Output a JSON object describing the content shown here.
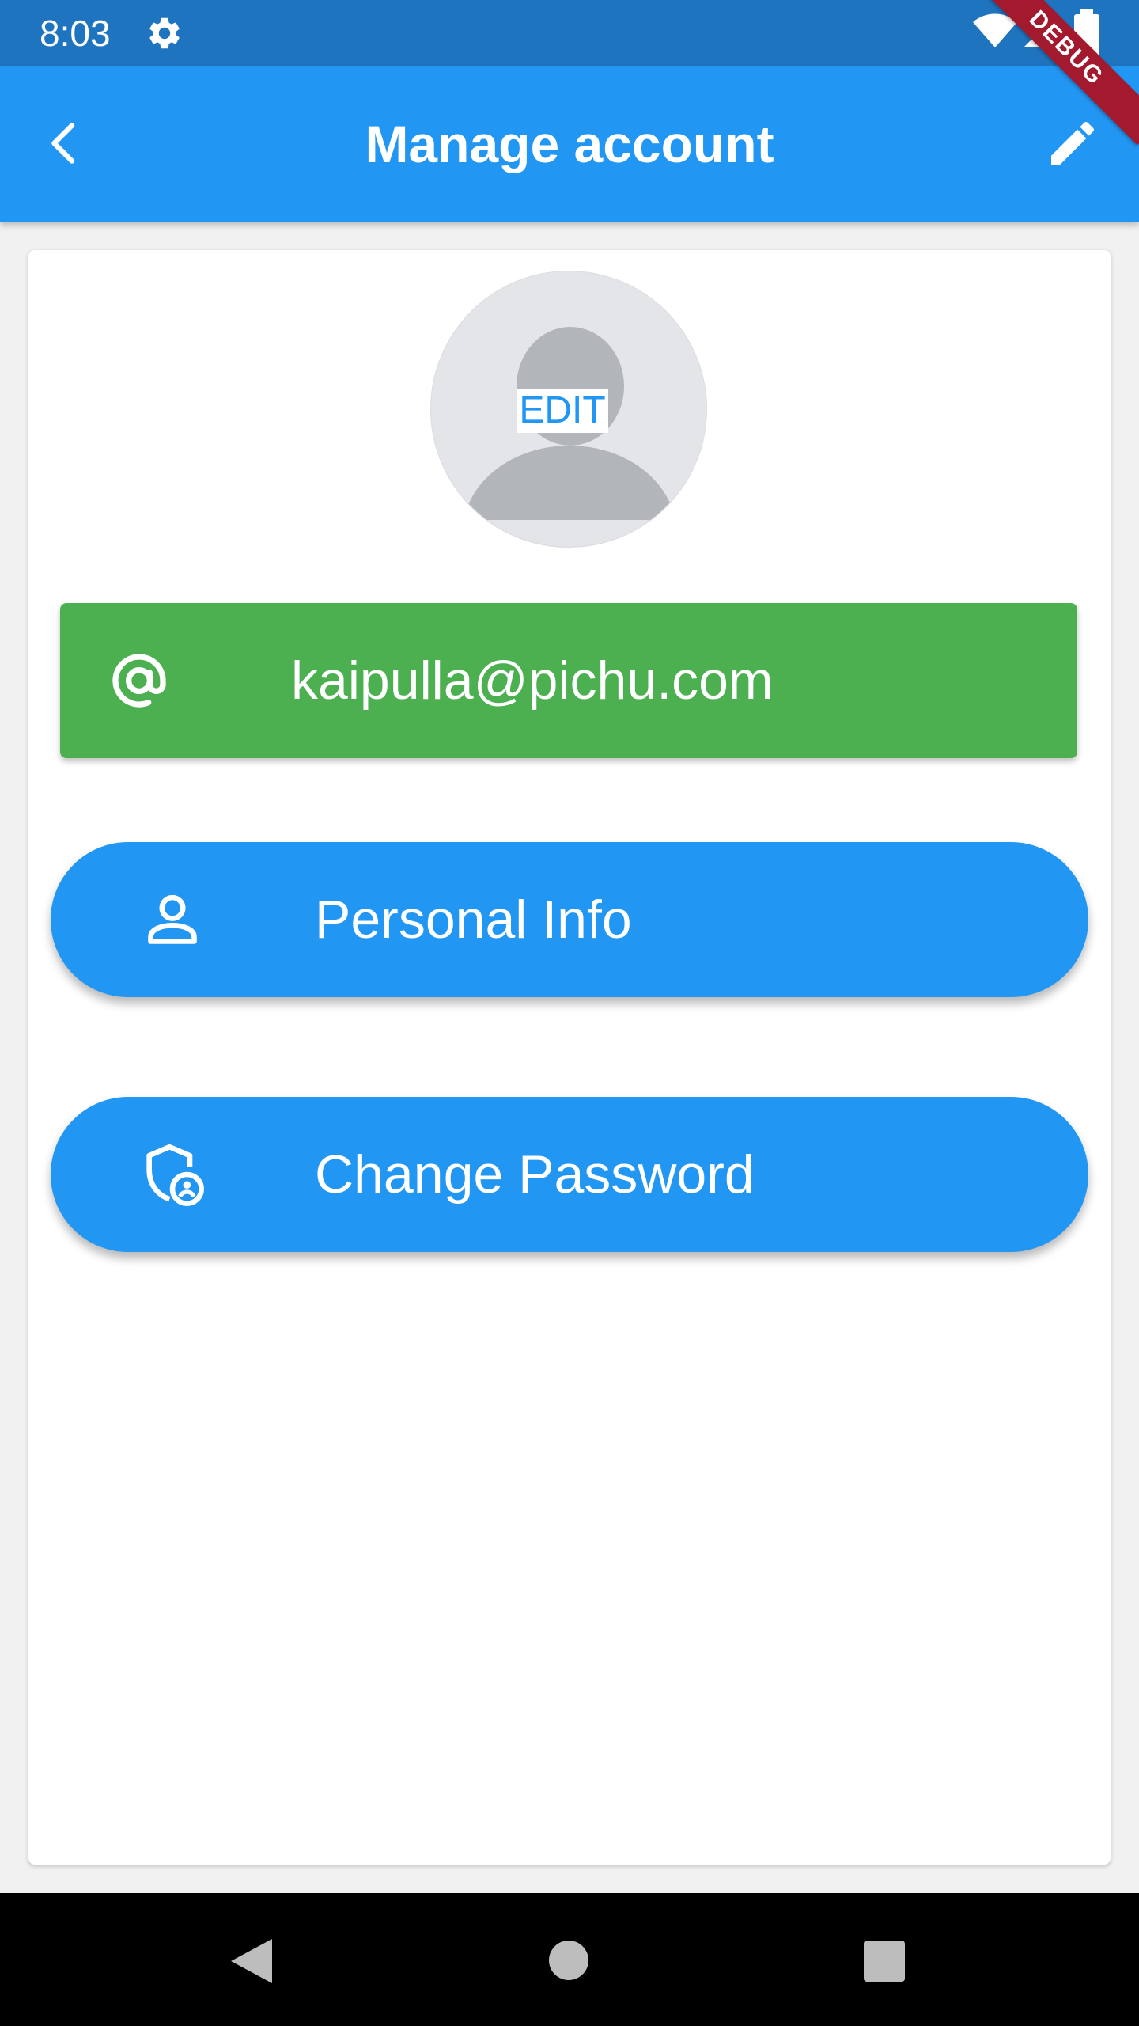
{
  "status_bar": {
    "time": "8:03",
    "icons": [
      "settings-icon",
      "wifi-icon",
      "signal-icon",
      "battery-icon"
    ]
  },
  "app_bar": {
    "title": "Manage account",
    "back_icon": "chevron-left-icon",
    "edit_icon": "pencil-icon"
  },
  "debug_banner": "DEBUG",
  "profile": {
    "avatar_edit_label": "EDIT",
    "email": "kaipulla@pichu.com",
    "email_icon": "at-sign-icon"
  },
  "actions": [
    {
      "label": "Personal Info",
      "icon": "person-icon"
    },
    {
      "label": "Change Password",
      "icon": "shield-user-icon"
    }
  ],
  "colors": {
    "status_bar": "#1f74c0",
    "primary": "#2196f3",
    "email_row": "#4caf50",
    "debug_banner": "#a3192e",
    "avatar_bg": "#e4e5e8",
    "avatar_silhouette": "#b2b5ba"
  },
  "nav_bar": {
    "buttons": [
      "back-triangle-icon",
      "home-circle-icon",
      "recents-square-icon"
    ]
  }
}
